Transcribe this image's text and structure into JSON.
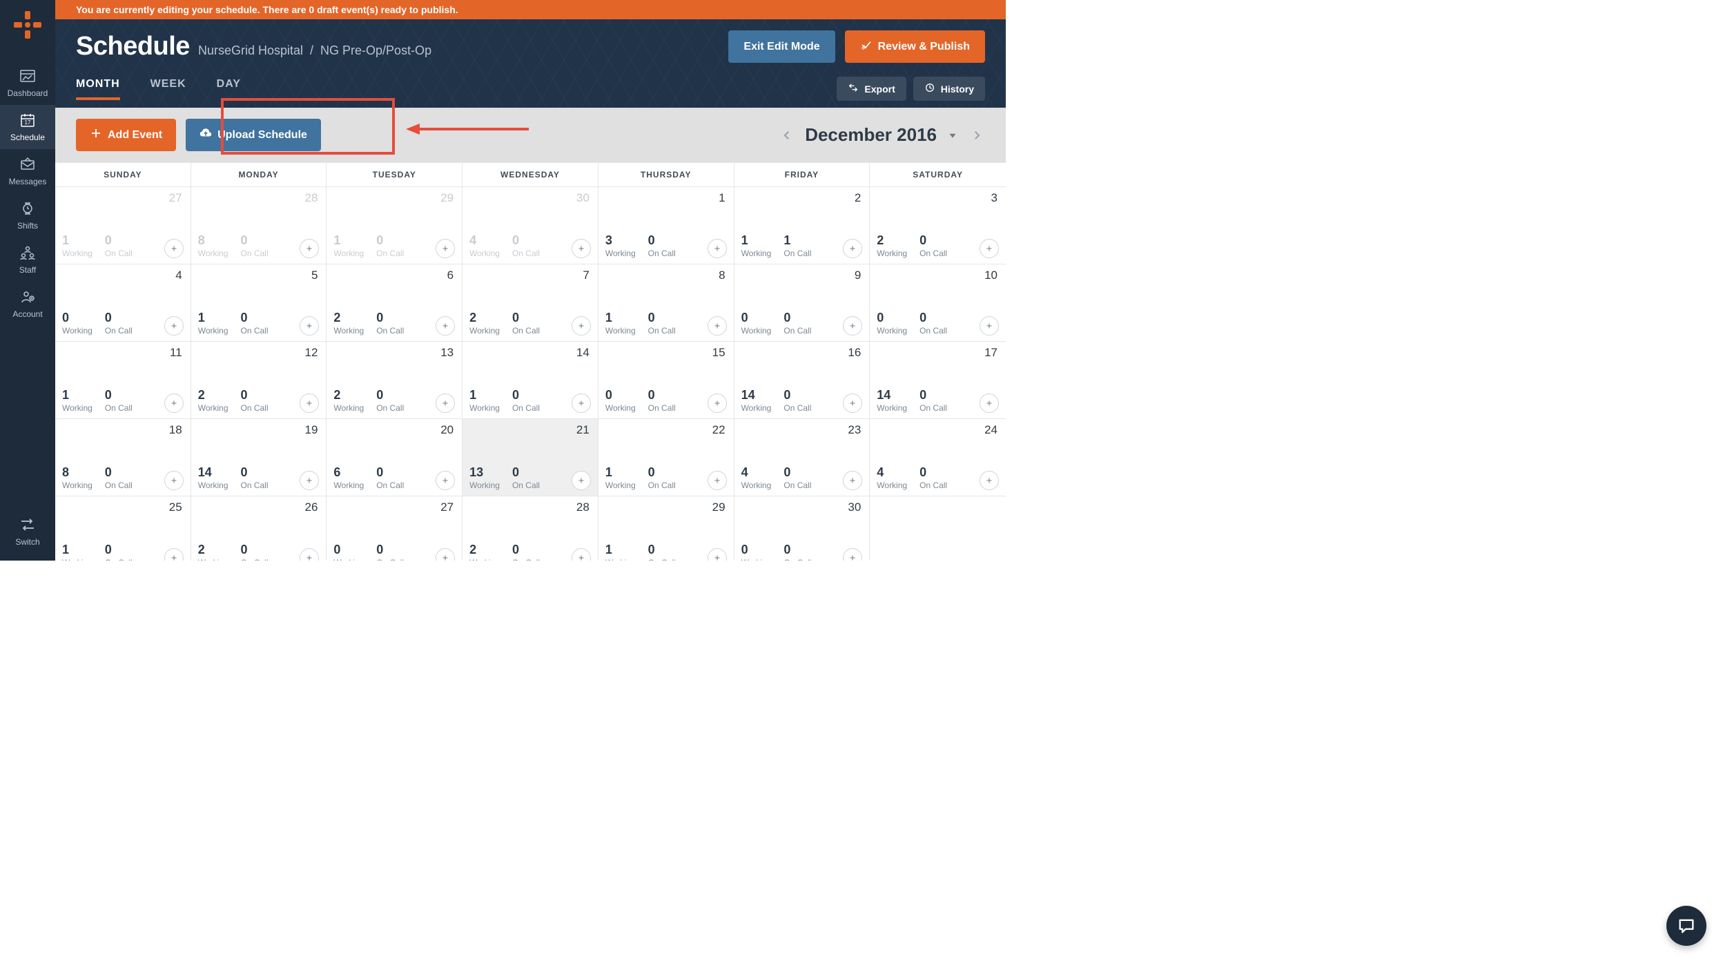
{
  "banner": {
    "text": "You are currently editing your schedule. There are 0 draft event(s) ready to publish."
  },
  "sidebar": {
    "items": [
      {
        "label": "Dashboard"
      },
      {
        "label": "Schedule"
      },
      {
        "label": "Messages"
      },
      {
        "label": "Shifts"
      },
      {
        "label": "Staff"
      },
      {
        "label": "Account"
      }
    ],
    "bottom": {
      "label": "Switch"
    }
  },
  "header": {
    "title": "Schedule",
    "breadcrumb": {
      "org": "NurseGrid Hospital",
      "dept": "NG Pre-Op/Post-Op"
    },
    "exit_label": "Exit Edit Mode",
    "publish_label": "Review & Publish"
  },
  "tabs": {
    "month": "MONTH",
    "week": "WEEK",
    "day": "DAY",
    "active": "MONTH"
  },
  "small_buttons": {
    "export": "Export",
    "history": "History"
  },
  "toolbar": {
    "add_event": "Add Event",
    "upload": "Upload Schedule",
    "month_label": "December 2016"
  },
  "calendar": {
    "dow": [
      "SUNDAY",
      "MONDAY",
      "TUESDAY",
      "WEDNESDAY",
      "THURSDAY",
      "FRIDAY",
      "SATURDAY"
    ],
    "stat_labels": {
      "working": "Working",
      "oncall": "On Call"
    },
    "days": [
      {
        "num": 27,
        "other": true,
        "working": 1,
        "oncall": 0
      },
      {
        "num": 28,
        "other": true,
        "working": 8,
        "oncall": 0
      },
      {
        "num": 29,
        "other": true,
        "working": 1,
        "oncall": 0
      },
      {
        "num": 30,
        "other": true,
        "working": 4,
        "oncall": 0
      },
      {
        "num": 1,
        "other": false,
        "working": 3,
        "oncall": 0
      },
      {
        "num": 2,
        "other": false,
        "working": 1,
        "oncall": 1
      },
      {
        "num": 3,
        "other": false,
        "working": 2,
        "oncall": 0
      },
      {
        "num": 4,
        "other": false,
        "working": 0,
        "oncall": 0
      },
      {
        "num": 5,
        "other": false,
        "working": 1,
        "oncall": 0
      },
      {
        "num": 6,
        "other": false,
        "working": 2,
        "oncall": 0
      },
      {
        "num": 7,
        "other": false,
        "working": 2,
        "oncall": 0
      },
      {
        "num": 8,
        "other": false,
        "working": 1,
        "oncall": 0
      },
      {
        "num": 9,
        "other": false,
        "working": 0,
        "oncall": 0
      },
      {
        "num": 10,
        "other": false,
        "working": 0,
        "oncall": 0
      },
      {
        "num": 11,
        "other": false,
        "working": 1,
        "oncall": 0
      },
      {
        "num": 12,
        "other": false,
        "working": 2,
        "oncall": 0
      },
      {
        "num": 13,
        "other": false,
        "working": 2,
        "oncall": 0
      },
      {
        "num": 14,
        "other": false,
        "working": 1,
        "oncall": 0
      },
      {
        "num": 15,
        "other": false,
        "working": 0,
        "oncall": 0
      },
      {
        "num": 16,
        "other": false,
        "working": 14,
        "oncall": 0
      },
      {
        "num": 17,
        "other": false,
        "working": 14,
        "oncall": 0
      },
      {
        "num": 18,
        "other": false,
        "working": 8,
        "oncall": 0
      },
      {
        "num": 19,
        "other": false,
        "working": 14,
        "oncall": 0
      },
      {
        "num": 20,
        "other": false,
        "working": 6,
        "oncall": 0
      },
      {
        "num": 21,
        "other": false,
        "working": 13,
        "oncall": 0,
        "today": true
      },
      {
        "num": 22,
        "other": false,
        "working": 1,
        "oncall": 0
      },
      {
        "num": 23,
        "other": false,
        "working": 4,
        "oncall": 0
      },
      {
        "num": 24,
        "other": false,
        "working": 4,
        "oncall": 0
      },
      {
        "num": 25,
        "other": false,
        "working": 1,
        "oncall": 0
      },
      {
        "num": 26,
        "other": false,
        "working": 2,
        "oncall": 0
      },
      {
        "num": 27,
        "other": false,
        "working": 0,
        "oncall": 0
      },
      {
        "num": 28,
        "other": false,
        "working": 2,
        "oncall": 0
      },
      {
        "num": 29,
        "other": false,
        "working": 1,
        "oncall": 0
      },
      {
        "num": 30,
        "other": false,
        "working": 0,
        "oncall": 0
      }
    ]
  }
}
